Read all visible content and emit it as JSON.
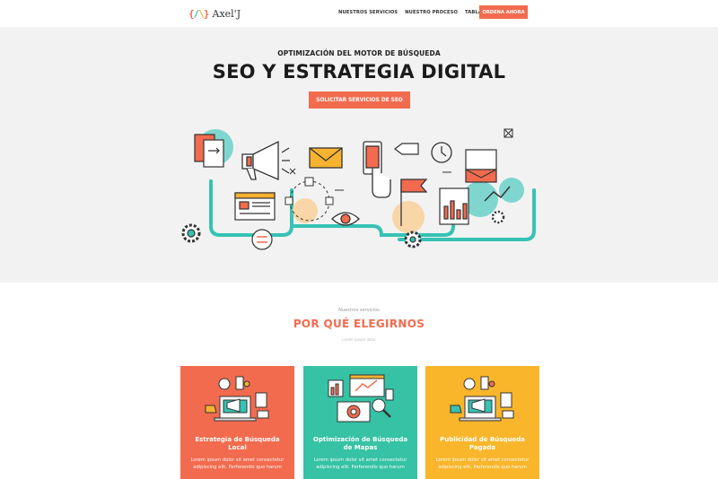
{
  "brand": {
    "mark": "{/\\}",
    "name": "Axel'J"
  },
  "nav": {
    "items": [
      "NUESTROS SERVICIOS",
      "NUESTRO PROCESO",
      "TABLA DE PRECIOS"
    ],
    "cta": "ORDENA AHORA"
  },
  "hero": {
    "eyebrow": "OPTIMIZACIÓN DEL MOTOR DE BÚSQUEDA",
    "title": "SEO Y ESTRATEGIA DIGITAL",
    "button": "SOLICITAR SERVICIOS DE SEO"
  },
  "services": {
    "kicker": "Nuestros servicios",
    "title": "POR QUÉ ELEGIRNOS",
    "subtitle": "Lorem ipsum dolor",
    "cards": [
      {
        "title": "Estrategia de Búsqueda Local",
        "body": "Lorem ipsum dolor sit amet consectetur adipiscing elit. Perferendis quo harum",
        "color": "#f26b4e"
      },
      {
        "title": "Optimización de Búsqueda de Mapas",
        "body": "Lorem ipsum dolor sit amet consectetur adipiscing elit. Perferendis quo harum",
        "color": "#36c2a4"
      },
      {
        "title": "Publicidad de Búsqueda Pagada",
        "body": "Lorem ipsum dolor sit amet consectetur adipiscing elit. Perferendis quo harum",
        "color": "#f9b62b"
      }
    ]
  },
  "colors": {
    "accent": "#f26b4e",
    "teal": "#36c2b4",
    "yellow": "#f7b22f",
    "hero_bg": "#f2f2f2"
  },
  "icons": [
    "megaphone-icon",
    "envelope-icon",
    "smartphone-icon",
    "clock-icon",
    "flag-icon",
    "gear-icon",
    "eye-icon",
    "document-icon",
    "chart-icon",
    "browser-window-icon"
  ]
}
